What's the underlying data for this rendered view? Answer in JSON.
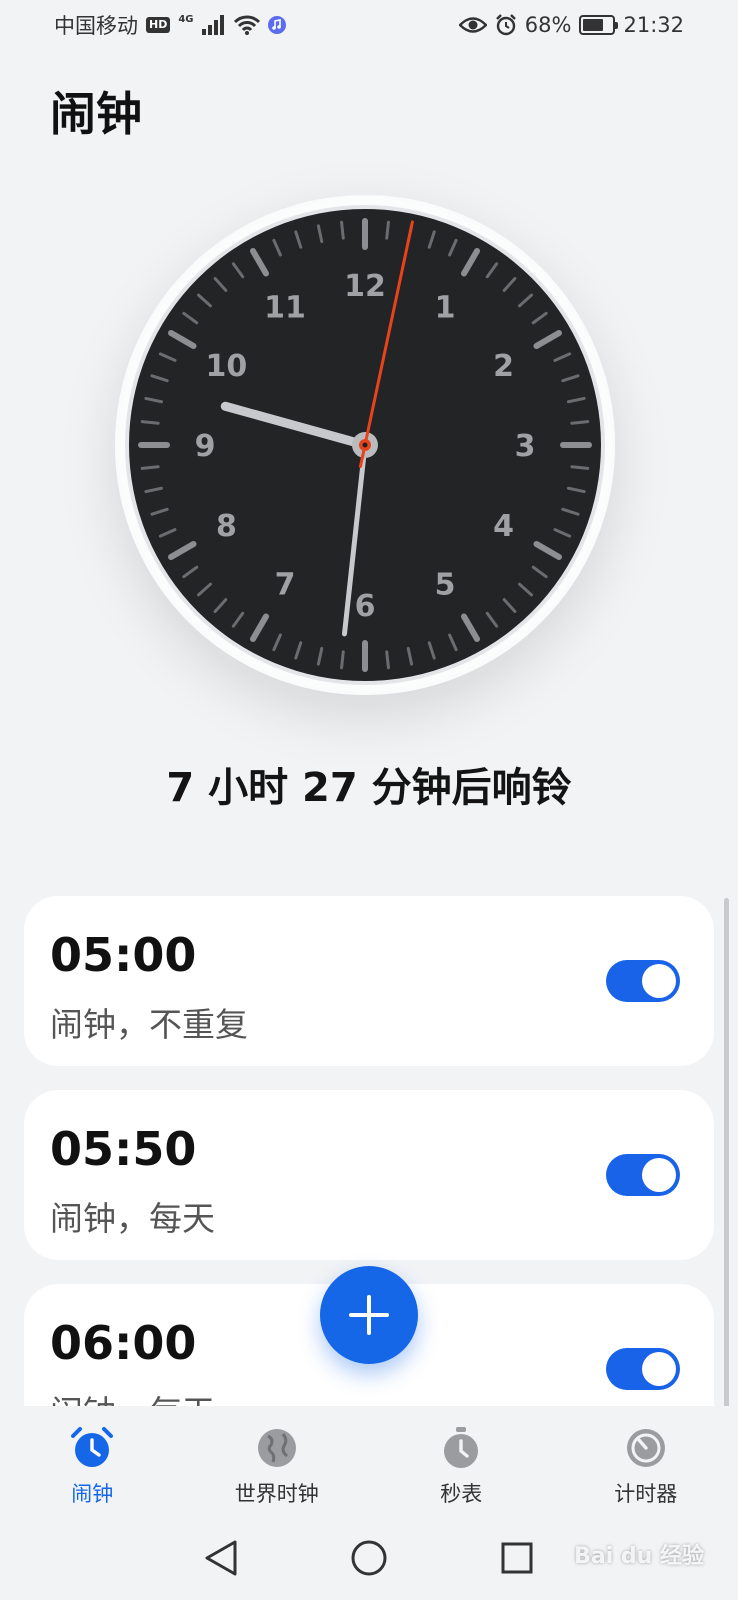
{
  "status_bar": {
    "carrier": "中国移动",
    "hd_badge": "HD",
    "network": "4G",
    "battery": "68%",
    "battery_level": 0.68,
    "time": "21:32"
  },
  "page_title": "闹钟",
  "clock": {
    "hour_numbers": [
      "12",
      "1",
      "2",
      "3",
      "4",
      "5",
      "6",
      "7",
      "8",
      "9",
      "10",
      "11"
    ],
    "time_shown": "09:31:02"
  },
  "countdown": "7 小时 27 分钟后响铃",
  "alarms": [
    {
      "time": "05:00",
      "desc": "闹钟，不重复",
      "enabled": true
    },
    {
      "time": "05:50",
      "desc": "闹钟，每天",
      "enabled": true
    },
    {
      "time": "06:00",
      "desc": "闹钟，每天",
      "enabled": true
    }
  ],
  "bottom_nav": [
    {
      "label": "闹钟",
      "icon": "alarm-clock-icon",
      "active": true
    },
    {
      "label": "世界时钟",
      "icon": "globe-icon",
      "active": false
    },
    {
      "label": "秒表",
      "icon": "stopwatch-icon",
      "active": false
    },
    {
      "label": "计时器",
      "icon": "timer-icon",
      "active": false
    }
  ],
  "watermark": "Bai du 经验",
  "colors": {
    "accent": "#1567e8",
    "second_hand": "#e8431b",
    "clock_face": "#232425"
  }
}
